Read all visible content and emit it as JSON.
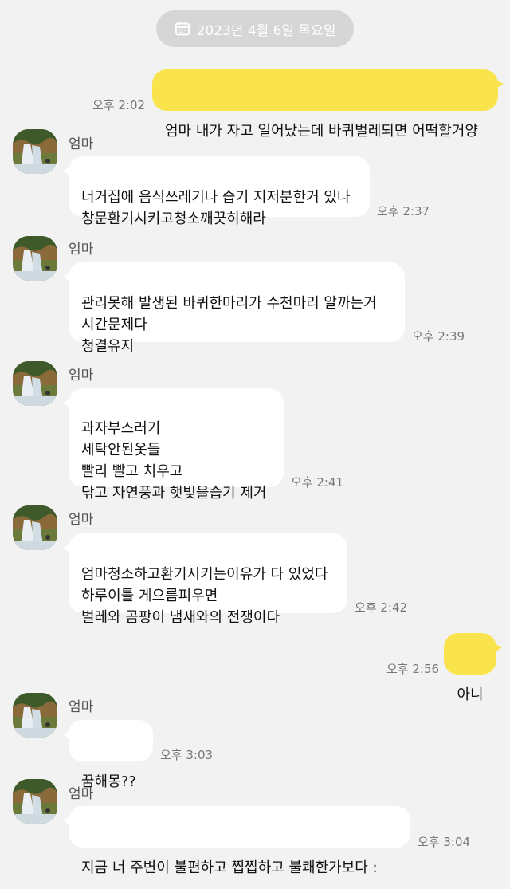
{
  "date_divider": "2023년 4월 6일 목요일",
  "sender_name": "엄마",
  "messages": [
    {
      "text": "엄마 내가 자고 일어났는데 바퀴벌레되면 어떡할거양",
      "time": "오후 2:02"
    },
    {
      "text": "너거집에 음식쓰레기나 습기 지저분한거 있나\n창문환기시키고청소깨끗히해라",
      "time": "오후 2:37"
    },
    {
      "text": "관리못해 발생된 바퀴한마리가  수천마리 알까는거\n시간문제다\n청결유지",
      "time": "오후 2:39"
    },
    {
      "text": "과자부스러기\n세탁안된옷들\n빨리 빨고 치우고\n닦고 자연풍과 햇빛을습기 제거",
      "time": "오후 2:41"
    },
    {
      "text": "엄마청소하고환기시키는이유가 다 있었다\n하루이틀 게으름피우면\n벌레와 곰팡이  냄새와의 전쟁이다",
      "time": "오후 2:42"
    },
    {
      "text": "아니",
      "time": "오후 2:56"
    },
    {
      "text": "꿈해몽??",
      "time": "오후 3:03"
    },
    {
      "text": "지금 너   주변이 불편하고 찝찝하고 불쾌한가보다 :",
      "time": "오후 3:04"
    }
  ],
  "colors": {
    "background": "#f2f2f2",
    "my_bubble": "#fae44e",
    "other_bubble": "#ffffff",
    "date_pill": "#d6d6d6"
  },
  "icons": [
    "calendar-icon",
    "avatar-waterfall-photo"
  ]
}
